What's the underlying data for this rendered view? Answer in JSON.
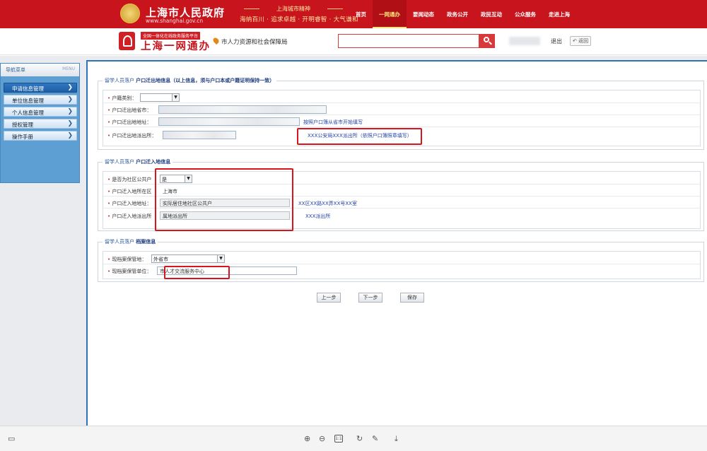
{
  "header": {
    "gov_title": "上海市人民政府",
    "gov_url": "www.shanghai.gov.cn",
    "slogan_top": "上海城市精神",
    "slogan_bottom": "海纳百川 · 追求卓越 · 开明睿智 · 大气谦和",
    "nav": [
      "首页",
      "一网通办",
      "要闻动态",
      "政务公开",
      "政民互动",
      "公众服务",
      "走进上海"
    ],
    "nav_active": "一网通办"
  },
  "subheader": {
    "platform_tag": "全国一体化在线政务服务平台",
    "platform_name": "上海一网通办",
    "org_name": "市人力资源和社会保障局",
    "search_placeholder": "",
    "logout": "退出",
    "back": "返回"
  },
  "sidebar": {
    "title": "导航菜单",
    "menu_tag": "MENU",
    "items": [
      {
        "label": "申请信息管理",
        "active": true
      },
      {
        "label": "单位信息管理",
        "active": false
      },
      {
        "label": "个人信息管理",
        "active": false
      },
      {
        "label": "授权管理",
        "active": false
      },
      {
        "label": "操作手册",
        "active": false
      }
    ]
  },
  "section1": {
    "legend_prefix": "留学人员落户",
    "legend_title": "户口迁出地信息（以上信息，须与户口本或户籍证明保持一致）",
    "fields": {
      "hukou_type": {
        "label": "户籍类别：",
        "value": ""
      },
      "province_city": {
        "label": "户口迁出地省市：",
        "value": ""
      },
      "address": {
        "label": "户口迁出地地址：",
        "value": "",
        "hint": "按照户口簿从省市开始填写"
      },
      "police_station": {
        "label": "户口迁出地派出所：",
        "value": ""
      }
    },
    "station_example": "XXX公安局XXX派出所（依照户口簿照章填写）"
  },
  "section2": {
    "legend_prefix": "留学人员落户",
    "legend_title": "户口迁入地信息",
    "fields": {
      "community": {
        "label": "是否为社区公共户",
        "value": "是"
      },
      "district": {
        "label": "户口迁入地所在区",
        "value": "上海市"
      },
      "address": {
        "label": "户口迁入地地址：",
        "value": "实际居住地社区公共户",
        "hint": "XX区XX路XX弄XX号XX室"
      },
      "police_station": {
        "label": "户口迁入地派出所",
        "value": "属地派出所",
        "hint": "XXX派出所"
      }
    }
  },
  "section3": {
    "legend_prefix": "留学人员落户",
    "legend_title": "档案信息",
    "fields": {
      "archive_place": {
        "label": "现档案保管地：",
        "value": "外省市"
      },
      "archive_unit": {
        "label": "现档案保管单位：",
        "value": "市人才交流服务中心"
      }
    }
  },
  "buttons": {
    "prev": "上一步",
    "next": "下一步",
    "save": "保存"
  },
  "viewer": {
    "fit_label": "1:1"
  }
}
